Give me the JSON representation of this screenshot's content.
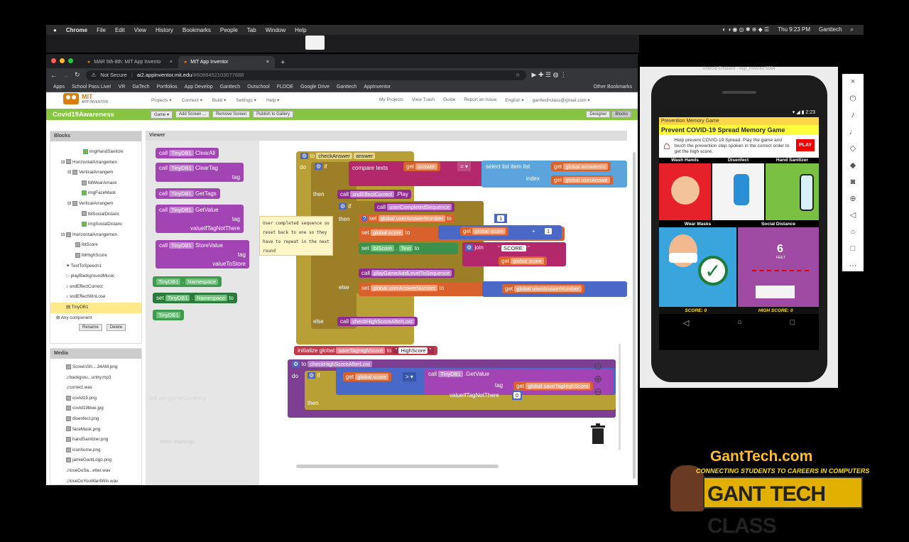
{
  "menubar": {
    "apple": "",
    "app": "Chrome",
    "items": [
      "File",
      "Edit",
      "View",
      "History",
      "Bookmarks",
      "People",
      "Tab",
      "Window",
      "Help"
    ],
    "clock": "Thu 9:23 PM",
    "user": "Ganttech"
  },
  "browser": {
    "tabs": [
      {
        "title": "MAR 5th-8th: MIT App Invento"
      },
      {
        "title": "MIT App Inventor"
      }
    ],
    "url_prefix": "Not Secure",
    "url": "ai2.appinventor.mit.edu",
    "url_hash": "/#6088452103077888",
    "bookmarks": [
      "Apps",
      "School Pass Live!",
      "VR",
      "GaTech",
      "Portfolios",
      "App Develop",
      "Ganttech",
      "Outschool",
      "FLDOE",
      "Google Drive",
      "Ganttech",
      "AppInventor"
    ],
    "other_bookmarks": "Other Bookmarks"
  },
  "appinventor": {
    "logo_top": "MIT",
    "logo_bottom": "APP INVENTOR",
    "menus": [
      "Projects ▾",
      "Connect ▾",
      "Build ▾",
      "Settings ▾",
      "Help ▾"
    ],
    "right_menus": [
      "My Projects",
      "View Trash",
      "Guide",
      "Report an Issue",
      "English ▾",
      "ganttechclass@gmail.com ▾"
    ],
    "project": "Covid19Awareness",
    "screen_btn": "Game ▾",
    "buttons": [
      "Add Screen ...",
      "Remove Screen",
      "Publish to Gallery"
    ],
    "designer": "Designer",
    "blocks": "Blocks"
  },
  "blocks_panel": {
    "header": "Blocks",
    "tree": [
      "imgHandSanitize",
      "HorizontalArrangemen",
      "VerticalArrangem",
      "lblWearAmask",
      "imgFaceMask",
      "VerticalArrangem",
      "lblSocialDistanc",
      "imgSocialDistanc",
      "HorizontalArrangemen",
      "lblScore",
      "lblHighScore",
      "TextToSpeech1",
      "playBackgroundMusic",
      "sndEffectCorrect",
      "sndEffectWinLose",
      "TinyDB1",
      "Any component"
    ],
    "rename": "Rename",
    "delete": "Delete"
  },
  "media_panel": {
    "header": "Media",
    "files": [
      "ScreenSh....34AM.png",
      "backgrou...untry.mp3",
      "correct.wav",
      "covid19.png",
      "covid19blue.jpg",
      "disenfect.png",
      "faceMask.png",
      "handSanitizer.png",
      "iconhome.png",
      "jamieGantLogo.png",
      "loseDoSa...etter.wav",
      "loseDoYouWantWin.wav"
    ]
  },
  "viewer": {
    "header": "Viewer",
    "flyout": {
      "clearall": [
        "call",
        "TinyDB1",
        "ClearAll"
      ],
      "cleartag": [
        "call",
        "TinyDB1",
        "ClearTag",
        "tag"
      ],
      "gettags": [
        "call",
        "TinyDB1",
        "GetTags"
      ],
      "getvalue": [
        "call",
        "TinyDB1",
        "GetValue",
        "tag",
        "valueIfTagNotThere"
      ],
      "storevalue": [
        "call",
        "TinyDB1",
        "StoreValue",
        "tag",
        "valueToStore"
      ],
      "namespace_get": [
        "TinyDB1",
        "Namespace"
      ],
      "namespace_set": [
        "set",
        "TinyDB1",
        "Namespace",
        "to"
      ],
      "tinydb": "TinyDB1"
    },
    "comment": "User completed sequence so reset back to one so they have to repeat in the next round",
    "check_answer": {
      "to": "to",
      "name": "checkAnswer",
      "param": "answer",
      "do": "do",
      "if": "if",
      "compare": "compare texts",
      "get": "get",
      "answer": "answer",
      "eq": "=",
      "select": "select list item",
      "list": "list",
      "index": "index",
      "global_answers": "global answersIn",
      "global_user": "global userAnswe",
      "then": "then",
      "call": "call",
      "snd": "sndEffectCorrect",
      "play": ".Play",
      "user_seq": "userCompletedSequence",
      "set": "set",
      "user_ans_num": "global userAnswerNumber",
      "to_kw": "to",
      "one": "1",
      "global_score": "global score",
      "plus": "+",
      "lbl_score": "lblScore",
      "text": "Text",
      "join": "join",
      "score_text": "SCORE:",
      "level": "playGameAddLevelToSequence",
      "else": "else",
      "check_high": "checkHighScoreAfterLost"
    },
    "init": {
      "initialize": "initialize global",
      "name": "saveTagHighScore",
      "to": "to",
      "value": "HighScore"
    },
    "check_high_proc": {
      "to": "to",
      "name": "checkHighScoreAfterLost",
      "do": "do",
      "if": "if",
      "get": "get",
      "global_score": "global score",
      "gt": ">",
      "call": "call",
      "tinydb": "TinyDB1",
      "getvalue": ".GetValue",
      "tag": "tag",
      "save_tag": "global saveTagHighScore",
      "value_if": "valueIfTagNotThere",
      "zero": "0",
      "then": "then"
    },
    "faded": [
      "not",
      "get gameSpeaking",
      "Show Warnings"
    ]
  },
  "emulator": {
    "title": "Android Emulator - App_Inventor:5554",
    "time": "2:23",
    "appbar": "Prevention Memory Game",
    "app_title": "Prevent COVID-19 Spread Memory Game",
    "instructions": "Help prevent COVID-19 Spread. Play the game and touch the prevention step spoken in the correct order to get the high score.",
    "play": "PLAY",
    "captions": [
      "Wash Hands",
      "Disenfect",
      "Hand Sanitizer",
      "Wear Masks",
      "Social Distance"
    ],
    "score": "SCORE: 0",
    "high": "HIGH SCORE: 0",
    "six": "6",
    "feet": "FEET"
  },
  "branding": {
    "site": "GantTech.com",
    "tag": "CONNECTING STUDENTS TO CAREERS IN COMPUTERS",
    "banner": "GANT TECH CLASS"
  }
}
